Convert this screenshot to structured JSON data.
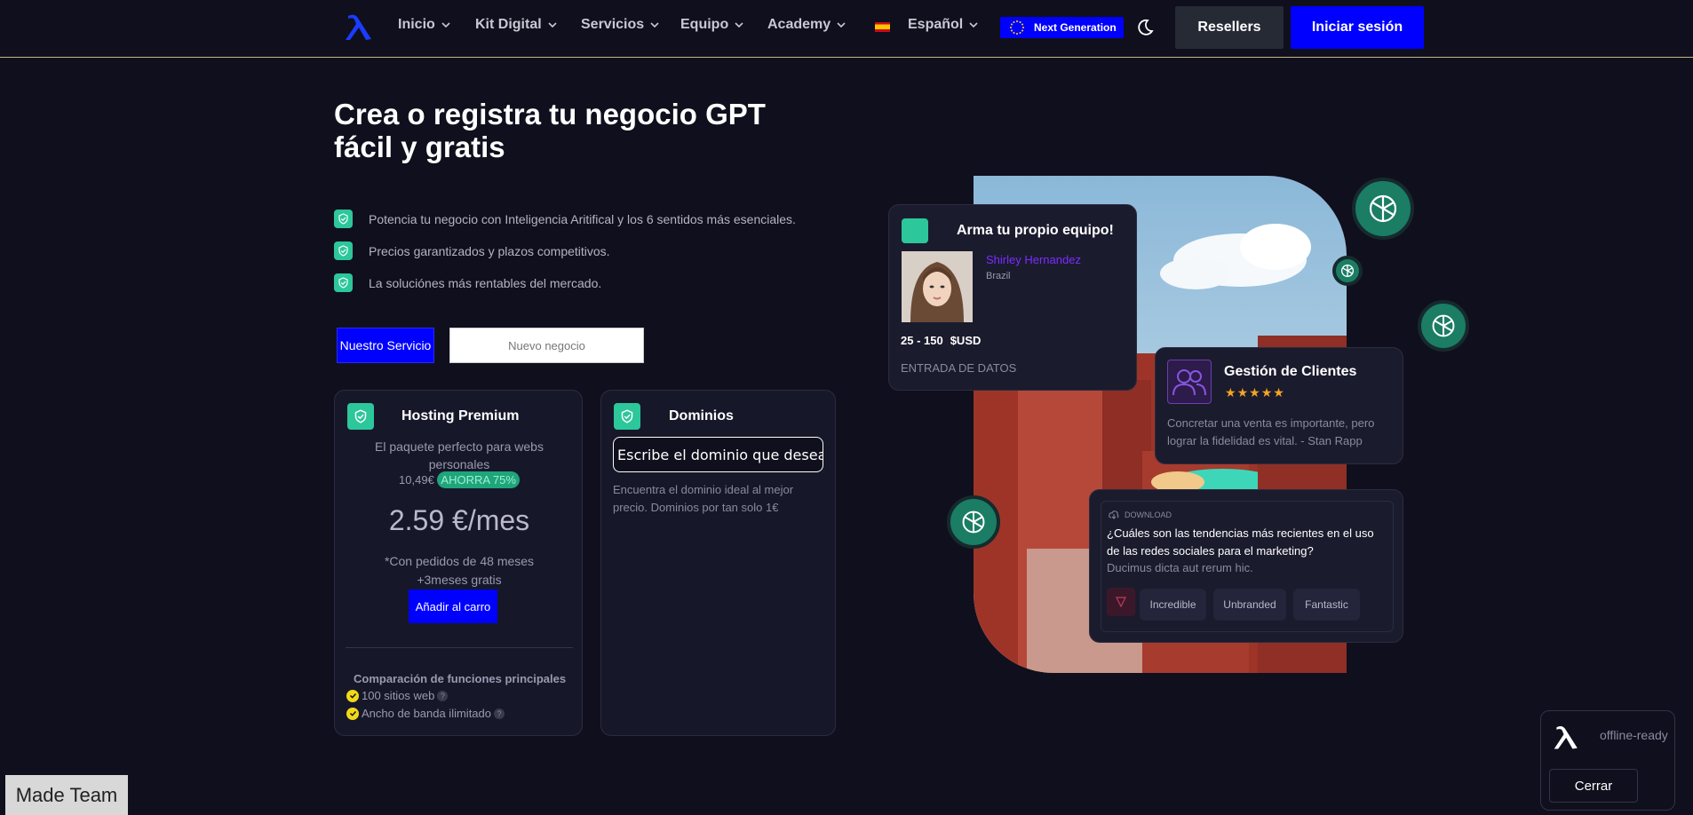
{
  "nav": {
    "items": [
      {
        "label": "Inicio"
      },
      {
        "label": "Kit Digital"
      },
      {
        "label": "Servicios"
      },
      {
        "label": "Equipo"
      },
      {
        "label": "Academy"
      }
    ],
    "language": "Español",
    "badge": "Next Generation",
    "resellers": "Resellers",
    "login": "Iniciar sesión"
  },
  "hero": {
    "title": "Crea o registra tu negocio GPT fácil y gratis",
    "features": [
      "Potencia tu negocio con Inteligencia Aritifical y los 6 sentidos más esenciales.",
      "Precios garantizados y plazos competitivos.",
      "La soluciónes más rentables del mercado."
    ],
    "btn_servicio": "Nuestro Servicio",
    "btn_nuevo": "Nuevo negocio"
  },
  "hosting": {
    "title": "Hosting Premium",
    "desc": "El paquete perfecto para webs personales",
    "old_price": "10,49€",
    "save": "AHORRA 75%",
    "price": "2.59 €/mes",
    "note": "*Con pedidos de 48 meses +3meses gratis",
    "cart": "Añadir al carro",
    "compare_title": "Comparación de funciones principales",
    "compare": [
      "100 sitios web",
      "Ancho de banda ilimitado"
    ]
  },
  "dominios": {
    "title": "Dominios",
    "placeholder": "Escribe el dominio que deseas",
    "desc": "Encuentra el dominio ideal al mejor precio. Dominios por tan solo 1€"
  },
  "team_card": {
    "title": "Arma tu propio equipo!",
    "name": "Shirley Hernandez",
    "country": "Brazil",
    "range": "25 - 150",
    "currency": "$USD",
    "footer": "ENTRADA DE DATOS"
  },
  "client_card": {
    "title": "Gestión de Clientes",
    "stars": 5,
    "quote": "Concretar una venta es importante, pero lograr la fidelidad es vital. - Stan Rapp"
  },
  "download_card": {
    "label": "DOWNLOAD",
    "question": "¿Cuáles son las tendencias más recientes en el uso de las redes sociales para el marketing?",
    "sub": "Ducimus dicta aut rerum hic.",
    "tags": [
      "Incredible",
      "Unbranded",
      "Fantastic"
    ]
  },
  "pwa": {
    "status": "offline-ready",
    "close": "Cerrar"
  },
  "footer_badge": "Made Team",
  "colors": {
    "accent": "#0000ff",
    "green": "#2cc79a",
    "bg": "#100f1d"
  }
}
